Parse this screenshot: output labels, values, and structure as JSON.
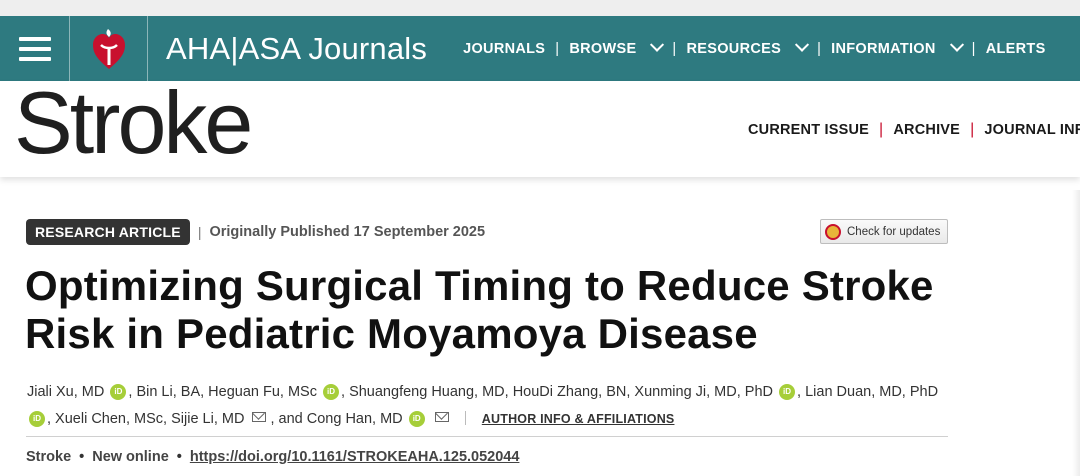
{
  "header": {
    "brand": "AHA|ASA Journals",
    "nav": [
      {
        "label": "JOURNALS",
        "dropdown": false
      },
      {
        "label": "BROWSE",
        "dropdown": true
      },
      {
        "label": "RESOURCES",
        "dropdown": true
      },
      {
        "label": "INFORMATION",
        "dropdown": true
      },
      {
        "label": "ALERTS",
        "dropdown": false
      }
    ],
    "colors": {
      "bar": "#2e7a80",
      "heart": "#c8102e"
    }
  },
  "journal": {
    "name": "Stroke",
    "nav": [
      "CURRENT ISSUE",
      "ARCHIVE",
      "JOURNAL INFOR"
    ]
  },
  "article": {
    "type_badge": "RESEARCH ARTICLE",
    "published": "Originally Published 17 September 2025",
    "check_updates": "Check for updates",
    "title": "Optimizing Surgical Timing to Reduce Stroke Risk in Pediatric Moyamoya Disease",
    "authors": {
      "a1": "Jiali Xu, MD",
      "a2": ", Bin Li, BA, Heguan Fu, MSc",
      "a3": ", Shuangfeng Huang, MD, HouDi Zhang, BN, Xunming Ji, MD, PhD",
      "a4": ", Lian Duan, MD, PhD",
      "a5": ", Xueli Chen, MSc, Sijie Li, MD",
      "a6": ", and Cong Han, MD",
      "orcid_label": "iD",
      "author_info_link": "AUTHOR INFO & AFFILIATIONS"
    },
    "footer": {
      "journal": "Stroke",
      "status": "New online",
      "doi": "https://doi.org/10.1161/STROKEAHA.125.052044"
    }
  }
}
